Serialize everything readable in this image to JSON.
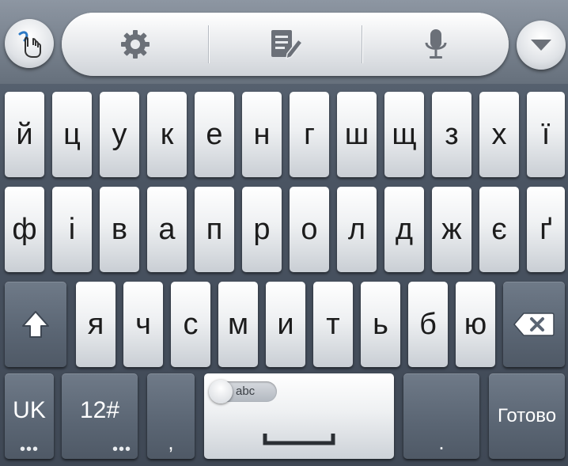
{
  "toolbar": {
    "left_button_icon": "swype-hand-icon",
    "settings_icon": "gear-icon",
    "edit_icon": "notepad-pencil-icon",
    "mic_icon": "microphone-icon",
    "hide_button_icon": "triangle-down-icon"
  },
  "rows": {
    "row1": [
      "й",
      "ц",
      "у",
      "к",
      "е",
      "н",
      "г",
      "ш",
      "щ",
      "з",
      "х",
      "ї"
    ],
    "row2": [
      "ф",
      "і",
      "в",
      "а",
      "п",
      "р",
      "о",
      "л",
      "д",
      "ж",
      "є",
      "ґ"
    ],
    "row3": [
      "я",
      "ч",
      "с",
      "м",
      "и",
      "т",
      "ь",
      "б",
      "ю"
    ]
  },
  "bottom": {
    "lang": "UK",
    "symbols": "12#",
    "comma": ",",
    "period": ".",
    "done": "Готово",
    "more_dots": "•••",
    "space_toggle": "abc"
  },
  "colors": {
    "accent_blue": "#2d7ac6",
    "key_text": "#1c1c1c",
    "function_key": "#5e6976"
  }
}
